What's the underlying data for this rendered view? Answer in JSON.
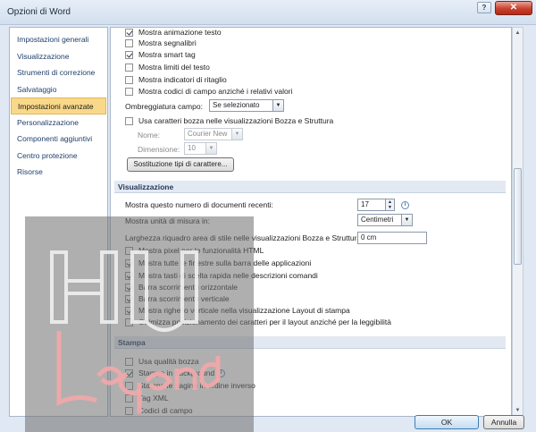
{
  "window": {
    "title": "Opzioni di Word",
    "help_glyph": "?",
    "close_glyph": "✕"
  },
  "sidebar": {
    "items": [
      {
        "label": "Impostazioni generali"
      },
      {
        "label": "Visualizzazione"
      },
      {
        "label": "Strumenti di correzione"
      },
      {
        "label": "Salvataggio"
      },
      {
        "label": "Impostazioni avanzate",
        "selected": true
      },
      {
        "label": "Personalizzazione"
      },
      {
        "label": "Componenti aggiuntivi"
      },
      {
        "label": "Centro protezione"
      },
      {
        "label": "Risorse"
      }
    ]
  },
  "show_document": {
    "options": [
      {
        "label": "Mostra animazione testo",
        "checked": true
      },
      {
        "label": "Mostra segnalibri",
        "checked": false
      },
      {
        "label": "Mostra smart tag",
        "checked": true
      },
      {
        "label": "Mostra limiti del testo",
        "checked": false
      },
      {
        "label": "Mostra indicatori di ritaglio",
        "checked": false
      },
      {
        "label": "Mostra codici di campo anziché i relativi valori",
        "checked": false
      }
    ],
    "field_shading_label": "Ombreggiatura campo:",
    "field_shading_value": "Se selezionato",
    "draft_font_label": "Usa caratteri bozza nelle visualizzazioni Bozza e Struttura",
    "font_name_label": "Nome:",
    "font_name_value": "Courier New",
    "font_size_label": "Dimensione:",
    "font_size_value": "10",
    "font_substitution_button": "Sostituzione tipi di carattere..."
  },
  "display": {
    "header": "Visualizzazione",
    "recent_docs_label": "Mostra questo numero di documenti recenti:",
    "recent_docs_value": "17",
    "units_label": "Mostra unità di misura in:",
    "units_value": "Centimetri",
    "style_area_label": "Larghezza riquadro area di stile nelle visualizzazioni Bozza e Struttura:",
    "style_area_value": "0 cm",
    "options": [
      {
        "label": "Mostra pixel per le funzionalità HTML",
        "checked": false
      },
      {
        "label": "Mostra tutte le finestre sulla barra delle applicazioni",
        "checked": true
      },
      {
        "label": "Mostra tasti di scelta rapida nelle descrizioni comandi",
        "checked": true
      },
      {
        "label": "Barra scorrimento orizzontale",
        "checked": true
      },
      {
        "label": "Barra scorrimento verticale",
        "checked": true
      },
      {
        "label": "Mostra righello verticale nella visualizzazione Layout di stampa",
        "checked": true
      },
      {
        "label": "Ottimizza posizionamento dei caratteri per il layout anziché per la leggibilità",
        "checked": false
      }
    ]
  },
  "print": {
    "header": "Stampa",
    "options": [
      {
        "label": "Usa qualità bozza",
        "checked": false
      },
      {
        "label": "Stampa in background",
        "checked": true,
        "info": true
      },
      {
        "label": "Stampa le pagine in ordine inverso",
        "checked": false
      },
      {
        "label": "Tag XML",
        "checked": false
      },
      {
        "label": "Codici di campo",
        "checked": false
      }
    ]
  },
  "footer": {
    "ok": "OK",
    "cancel": "Annulla"
  },
  "colors": {
    "selected_bg": "#f9d88a",
    "section_bg": "#e3e9f2",
    "close_red": "#c8412e"
  }
}
